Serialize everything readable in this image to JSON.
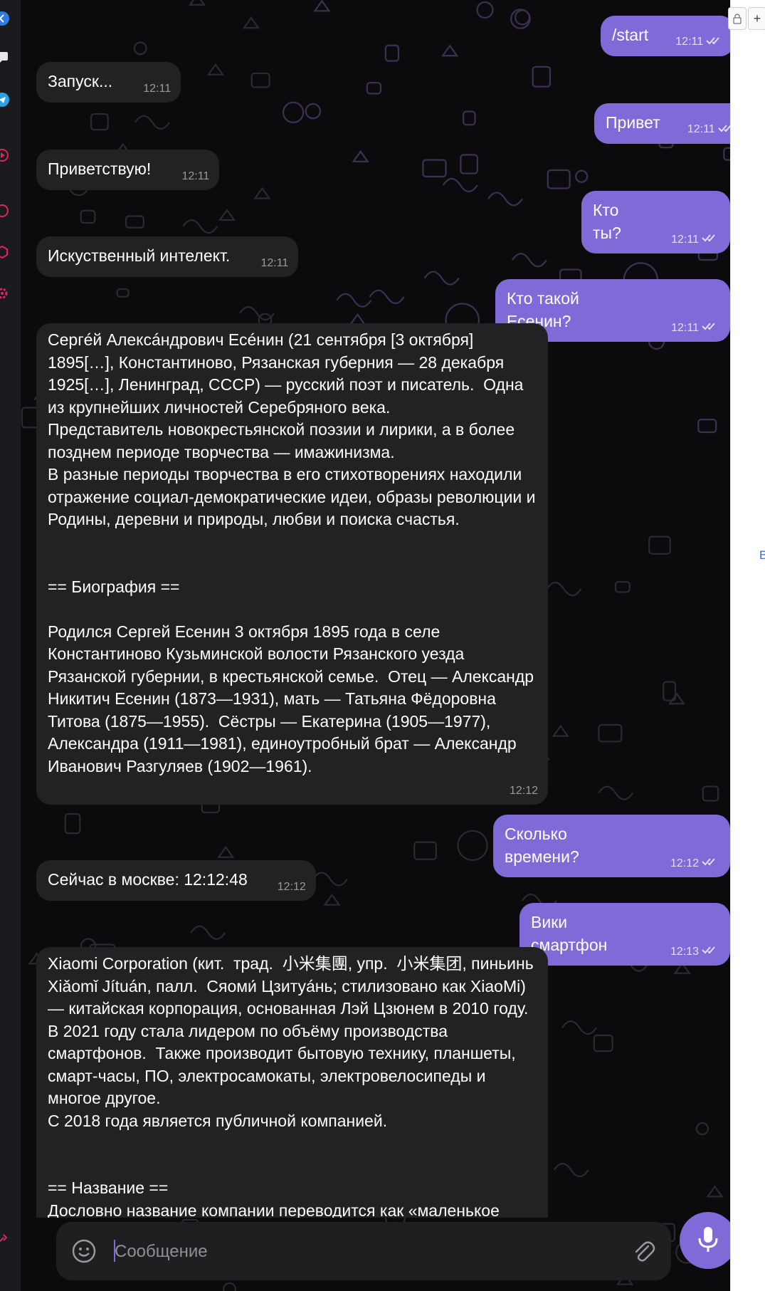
{
  "composer": {
    "placeholder": "Сообщение"
  },
  "right_panel": {
    "letter": "B",
    "btn_plus": "+"
  },
  "messages": [
    {
      "id": "m1",
      "dir": "out",
      "text": "/start",
      "time": "12:11",
      "read": true
    },
    {
      "id": "m2",
      "dir": "in",
      "text": "Запуск...",
      "time": "12:11"
    },
    {
      "id": "m3",
      "dir": "out",
      "text": "Привет",
      "time": "12:11",
      "read": true
    },
    {
      "id": "m4",
      "dir": "in",
      "text": "Приветствую!",
      "time": "12:11"
    },
    {
      "id": "m5",
      "dir": "out",
      "text": "Кто ты?",
      "time": "12:11",
      "read": true
    },
    {
      "id": "m6",
      "dir": "in",
      "text": "Искуственный интелект.",
      "time": "12:11"
    },
    {
      "id": "m7",
      "dir": "out",
      "text": "Кто такой Есенин?",
      "time": "12:11",
      "read": true
    },
    {
      "id": "m8",
      "dir": "in",
      "text": "Сергéй Алексáндрович Есéнин (21 сентября [3 октября] 1895[…], Константиново, Рязанская губерния — 28 декабря 1925[…], Ленинград, СССР) — русский поэт и писатель.  Одна из крупнейших личностей Серебряного века. \nПредставитель новокрестьянской поэзии и лирики, а в более позднем периоде творчества — имажинизма. \nВ разные периоды творчества в его стихотворениях находили отражение социал-демократические идеи, образы революции и Родины, деревни и природы, любви и поиска счастья.\n\n\n== Биография ==\n\nРодился Сергей Есенин 3 октября 1895 года в селе Константиново Кузьминской волости Рязанского уезда Рязанской губернии, в крестьянской семье.  Отец — Александр Никитич Есенин (1873—1931), мать — Татьяна Фёдоровна Титова (1875—1955).  Сёстры — Екатерина (1905—1977), Александра (1911—1981), единоутробный брат — Александр Иванович Разгуляев (1902—1961).",
      "time": "12:12"
    },
    {
      "id": "m9",
      "dir": "out",
      "text": "Сколько времени?",
      "time": "12:12",
      "read": true
    },
    {
      "id": "m10",
      "dir": "in",
      "text": "Сейчас в москве: 12:12:48",
      "time": "12:12"
    },
    {
      "id": "m11",
      "dir": "out",
      "text": "Вики смартфон",
      "time": "12:13",
      "read": true
    },
    {
      "id": "m12",
      "dir": "in",
      "text": "Xiaomi Corporation (кит.  трад.  小米集團, упр.  小米集团, пиньинь Xiǎomǐ Jítuán, палл.  Сяоми́ Цзитуáнь; стилизовано как XiaoMi) — китайская корпорация, основанная Лэй Цзюнем в 2010 году.  В 2021 году стала лидером по объёму производства смартфонов.  Также производит бытовую технику, планшеты, смарт-часы, ПО, электросамокаты, электровелосипеды и многое другое. \nС 2018 года является публичной компанией.\n\n\n== Название ==\nДословно название компании переводится как «маленькое",
      "time": ""
    }
  ]
}
